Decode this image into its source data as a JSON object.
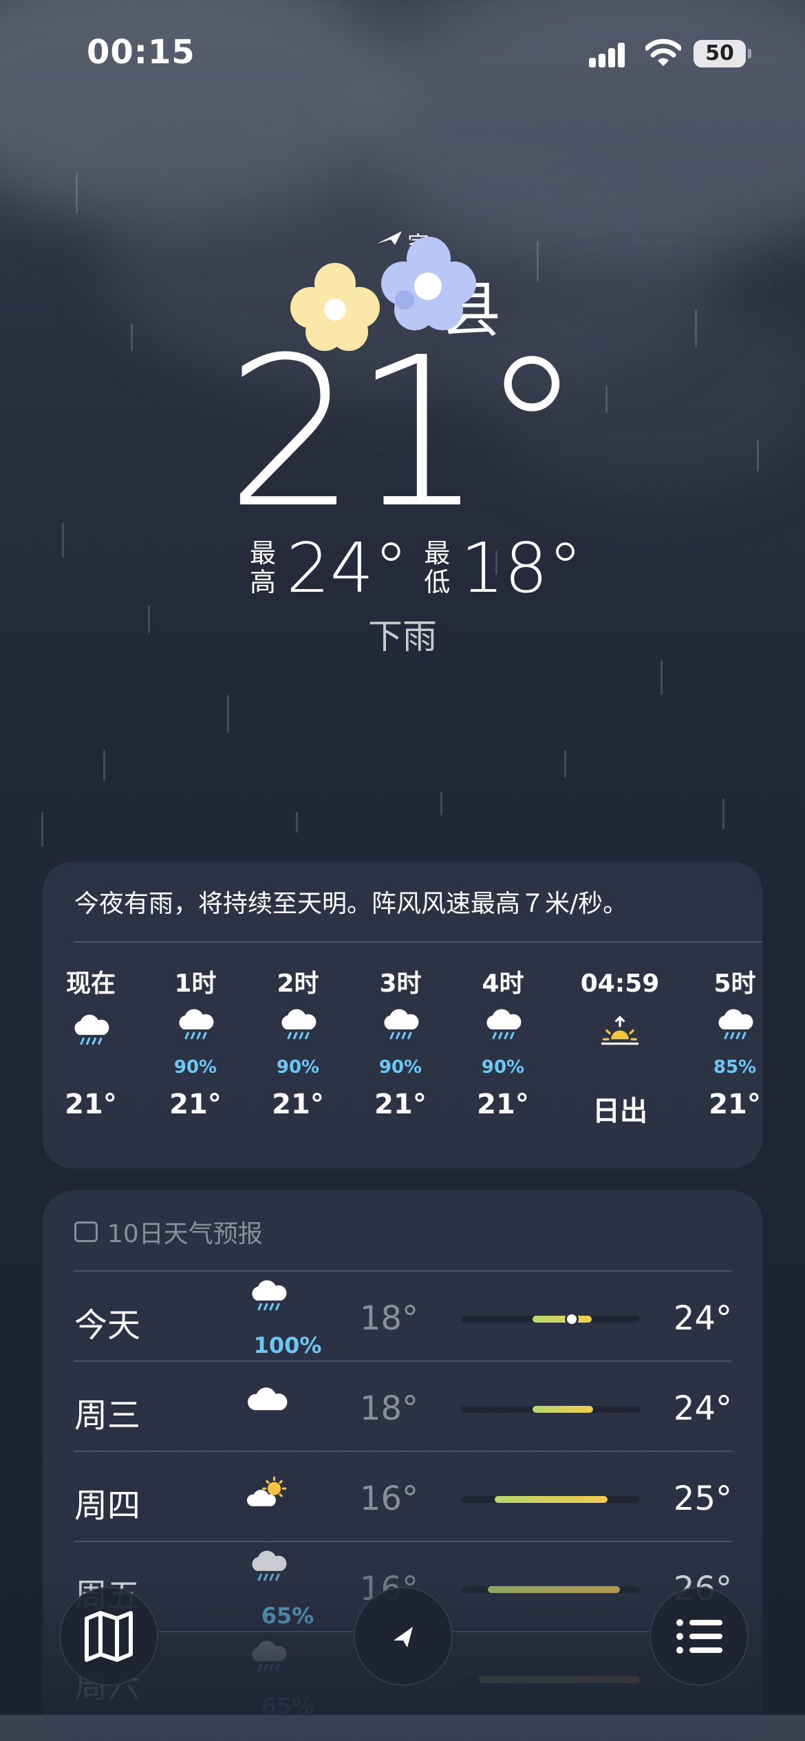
{
  "status_bar": {
    "time": "00:15",
    "battery": "50"
  },
  "location": {
    "home_label": "家",
    "city": "县",
    "current_temp": "21°",
    "high_label": "最高",
    "high": "24°",
    "low_label": "最低",
    "low": "18°",
    "condition": "下雨"
  },
  "hourly": {
    "summary": "今夜有雨，将持续至天明。阵风风速最高７米/秒。",
    "items": [
      {
        "label": "现在",
        "icon": "cloud-rain-icon",
        "pct": "",
        "temp": "21°"
      },
      {
        "label": "1时",
        "icon": "cloud-rain-icon",
        "pct": "90%",
        "temp": "21°"
      },
      {
        "label": "2时",
        "icon": "cloud-rain-icon",
        "pct": "90%",
        "temp": "21°"
      },
      {
        "label": "3时",
        "icon": "cloud-rain-icon",
        "pct": "90%",
        "temp": "21°"
      },
      {
        "label": "4时",
        "icon": "cloud-rain-icon",
        "pct": "90%",
        "temp": "21°"
      },
      {
        "label": "04:59",
        "icon": "sunrise-icon",
        "pct": "",
        "temp": "日出"
      },
      {
        "label": "5时",
        "icon": "cloud-rain-icon",
        "pct": "85%",
        "temp": "21°"
      }
    ]
  },
  "forecast": {
    "title": "10日天气预报",
    "days": [
      {
        "day": "今天",
        "icon": "cloud-rain-icon",
        "pct": "100%",
        "low": "18°",
        "high": "24°",
        "bar_start": 0.4,
        "bar_end": 0.73,
        "current": 0.62,
        "color": "#f3d24a"
      },
      {
        "day": "周三",
        "icon": "cloud-icon",
        "pct": "",
        "low": "18°",
        "high": "24°",
        "bar_start": 0.4,
        "bar_end": 0.74,
        "color": "#f3cd50"
      },
      {
        "day": "周四",
        "icon": "partly-cloudy-day-icon",
        "pct": "",
        "low": "16°",
        "high": "25°",
        "bar_start": 0.19,
        "bar_end": 0.82,
        "color": "#f2c94c"
      },
      {
        "day": "周五",
        "icon": "cloud-rain-icon",
        "pct": "65%",
        "low": "16°",
        "high": "26°",
        "bar_start": 0.15,
        "bar_end": 0.89,
        "color": "#e8c25a"
      },
      {
        "day": "周六",
        "icon": "cloud-rain-icon",
        "pct": "65%",
        "low": "",
        "high": "",
        "bar_start": 0.1,
        "bar_end": 1.0,
        "color": "#d9b45a"
      }
    ]
  },
  "toolbar": {
    "map": "map-icon",
    "location": "location-arrow-icon",
    "list": "list-icon"
  },
  "colors": {
    "precip": "#6cc7f5",
    "sun": "#f5c542",
    "flower_yellow": "#fbe7a8",
    "flower_blue": "#b8c7f5"
  }
}
